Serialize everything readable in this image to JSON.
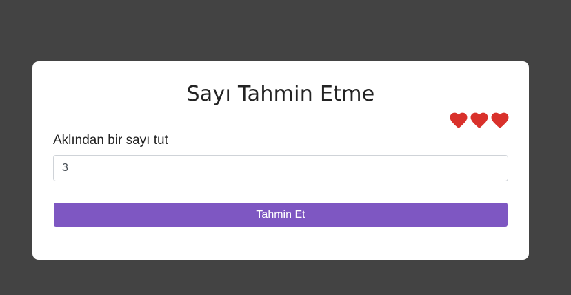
{
  "game": {
    "title": "Sayı Tahmin Etme",
    "lives": 3,
    "lives_icon": "heart-icon",
    "heart_color": "#d9312b",
    "input_label": "Aklından bir sayı tut",
    "input_value": "3",
    "button_label": "Tahmin Et"
  },
  "colors": {
    "page_background": "#434343",
    "card_background": "#ffffff",
    "button_background": "#7e57c2"
  }
}
